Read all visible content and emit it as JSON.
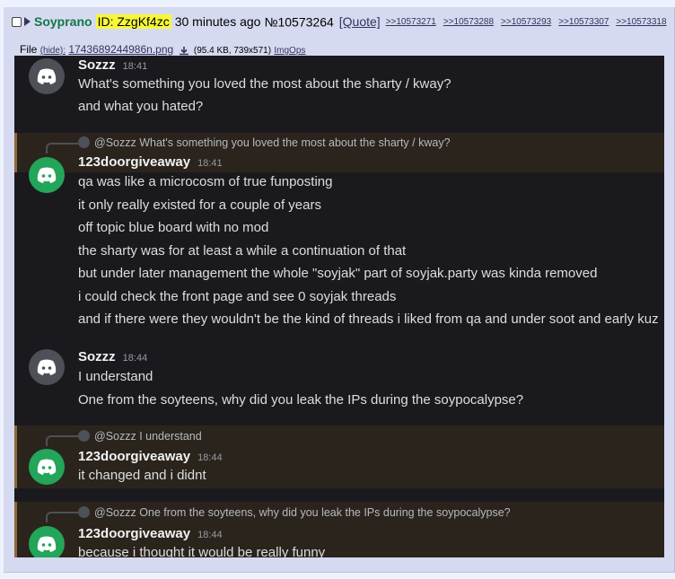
{
  "post": {
    "name": "Soyprano",
    "id": "ID: ZzgKf4zc",
    "time": "30 minutes ago",
    "number": "№10573264",
    "quote": "[Quote]",
    "backlinks": [
      ">>10573271",
      ">>10573288",
      ">>10573293",
      ">>10573307",
      ">>10573318"
    ]
  },
  "file": {
    "label": "File",
    "hide": "(hide):",
    "filename": "1743689244986n.png",
    "meta": "(95.4 KB, 739x571)",
    "imgops": "ImgOps"
  },
  "colors": {
    "name": "#117743",
    "id_bg": "#f7f73a",
    "discord_bg": "#1a1a1e",
    "highlight_bg": "#2b241c",
    "avatar_green": "#23a55a",
    "avatar_grey": "#4e5058"
  },
  "chat": {
    "m1": {
      "user": "Sozzz",
      "time": "18:41",
      "lines": [
        "What's something you loved the most about the sharty / kway?",
        "and what you hated?"
      ]
    },
    "m2": {
      "reply": "@Sozzz What's something you loved the most about the sharty / kway?",
      "user": "123doorgiveaway",
      "time": "18:41",
      "lines": [
        "qa was like a microcosm of true funposting",
        "it only really existed for a couple of years",
        "off topic blue board with no mod",
        "the sharty was for at least a while a continuation of that",
        "but under later management the whole \"soyjak\" part of soyjak.party was kinda removed",
        "i could check the front page and see 0 soyjak threads",
        "and if there were they wouldn't be the kind of threads i liked from qa and under soot and early kuz"
      ]
    },
    "m3": {
      "user": "Sozzz",
      "time": "18:44",
      "lines": [
        "I understand",
        "One from the soyteens, why did you leak the IPs during the soypocalypse?"
      ]
    },
    "m4": {
      "reply": "@Sozzz I understand",
      "user": "123doorgiveaway",
      "time": "18:44",
      "lines": [
        "it changed and i didnt"
      ]
    },
    "m5": {
      "reply": "@Sozzz One from the soyteens, why did you leak the IPs during the soypocalypse?",
      "user": "123doorgiveaway",
      "time": "18:44",
      "lines": [
        "because i thought it would be really funny"
      ]
    }
  }
}
